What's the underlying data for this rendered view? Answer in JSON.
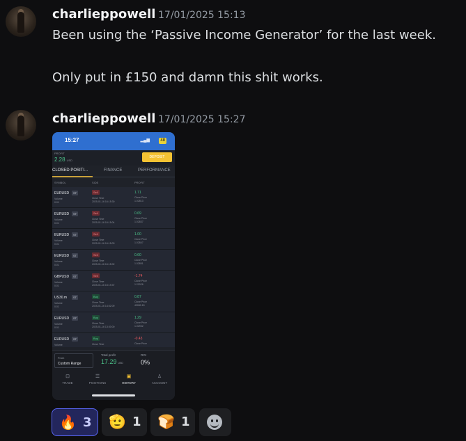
{
  "messages": [
    {
      "username": "charlieppowell",
      "timestamp": "17/01/2025 15:13",
      "lines": [
        "Been using the ‘Passive Income Generator’ for the last week.",
        "Only put in £150 and damn this shit works."
      ]
    },
    {
      "username": "charlieppowell",
      "timestamp": "17/01/2025 15:27"
    }
  ],
  "attachment": {
    "status_time": "15:27",
    "battery": "48",
    "profit_label": "PROFIT",
    "profit_value": "2.28",
    "profit_currency": "USD",
    "deposit_label": "DEPOSIT",
    "tabs": [
      "CLOSED POSITI...",
      "FINANCE",
      "PERFORMANCE"
    ],
    "columns": [
      "SYMBOL",
      "SIDE",
      "PROFIT"
    ],
    "rows": [
      {
        "symbol": "EURUSD",
        "lev": "ST",
        "vol_label": "Volume",
        "vol": "0.01",
        "side": "Sell",
        "side_type": "sell",
        "close_label": "Close Time",
        "close_time": "2025-01-16 16:15:30",
        "profit": "1.71",
        "profit_type": "pos",
        "cp_label": "Close Price",
        "close_price": "1.02813"
      },
      {
        "symbol": "EURUSD",
        "lev": "ST",
        "vol_label": "Volume",
        "vol": "0.01",
        "side": "Sell",
        "side_type": "sell",
        "close_label": "Close Time",
        "close_time": "2025-01-16 16:15:04",
        "profit": "0.69",
        "profit_type": "pos",
        "cp_label": "Close Price",
        "close_price": "1.02837"
      },
      {
        "symbol": "EURUSD",
        "lev": "ST",
        "vol_label": "Volume",
        "vol": "0.01",
        "side": "Sell",
        "side_type": "sell",
        "close_label": "Close Time",
        "close_time": "2025-01-16 16:15:03",
        "profit": "1.00",
        "profit_type": "pos",
        "cp_label": "Close Price",
        "close_price": "1.02847"
      },
      {
        "symbol": "EURUSD",
        "lev": "ST",
        "vol_label": "Volume",
        "vol": "0.01",
        "side": "Sell",
        "side_type": "sell",
        "close_label": "Close Time",
        "close_time": "2025-01-16 16:15:02",
        "profit": "0.60",
        "profit_type": "pos",
        "cp_label": "Close Price",
        "close_price": "1.02851"
      },
      {
        "symbol": "GBPUSD",
        "lev": "ST",
        "vol_label": "Volume",
        "vol": "0.01",
        "side": "Sell",
        "side_type": "sell",
        "close_label": "Close Time",
        "close_time": "2025-01-16 15:19:37",
        "profit": "-1.74",
        "profit_type": "neg",
        "cp_label": "Close Price",
        "close_price": "1.22026"
      },
      {
        "symbol": "US30.m",
        "lev": "ST",
        "vol_label": "Volume",
        "vol": "0.01",
        "side": "Buy",
        "side_type": "buy",
        "close_label": "Close Time",
        "close_time": "2025-01-16 14:52:09",
        "profit": "0.87",
        "profit_type": "pos",
        "cp_label": "Close Price",
        "close_price": "43080.15"
      },
      {
        "symbol": "EURUSD",
        "lev": "ST",
        "vol_label": "Volume",
        "vol": "0.01",
        "side": "Buy",
        "side_type": "buy",
        "close_label": "Close Time",
        "close_time": "2025-01-16 13:30:00",
        "profit": "1.29",
        "profit_type": "pos",
        "cp_label": "Close Price",
        "close_price": "1.02932"
      },
      {
        "symbol": "EURUSD",
        "lev": "ST",
        "vol_label": "Volume",
        "vol": "0.01",
        "side": "Buy",
        "side_type": "buy",
        "close_label": "Close Time",
        "close_time": "",
        "profit": "-0.43",
        "profit_type": "neg",
        "cp_label": "Close Price",
        "close_price": ""
      }
    ],
    "footer": {
      "from_label": "From",
      "from_value": "Custom Range",
      "total_profit_label": "Total profit",
      "total_profit_value": "17.29",
      "total_profit_currency": "USD",
      "roi_label": "ROI",
      "roi_value": "0%"
    },
    "nav": [
      {
        "label": "TRADE",
        "icon": "trade-icon",
        "glyph": "⊡"
      },
      {
        "label": "POSITIONS",
        "icon": "positions-icon",
        "glyph": "☰"
      },
      {
        "label": "HISTORY",
        "icon": "history-icon",
        "glyph": "▣"
      },
      {
        "label": "ACCOUNT",
        "icon": "account-icon",
        "glyph": "♙"
      }
    ]
  },
  "reactions": [
    {
      "emoji": "🔥",
      "icon": "fire-emoji",
      "count": "3",
      "active": true
    },
    {
      "emoji": "🫡",
      "icon": "saluting-face-emoji",
      "count": "1",
      "active": false
    },
    {
      "emoji": "🍞",
      "icon": "bread-emoji",
      "count": "1",
      "active": false
    }
  ],
  "add_reaction": {
    "icon": "add-reaction-icon"
  }
}
